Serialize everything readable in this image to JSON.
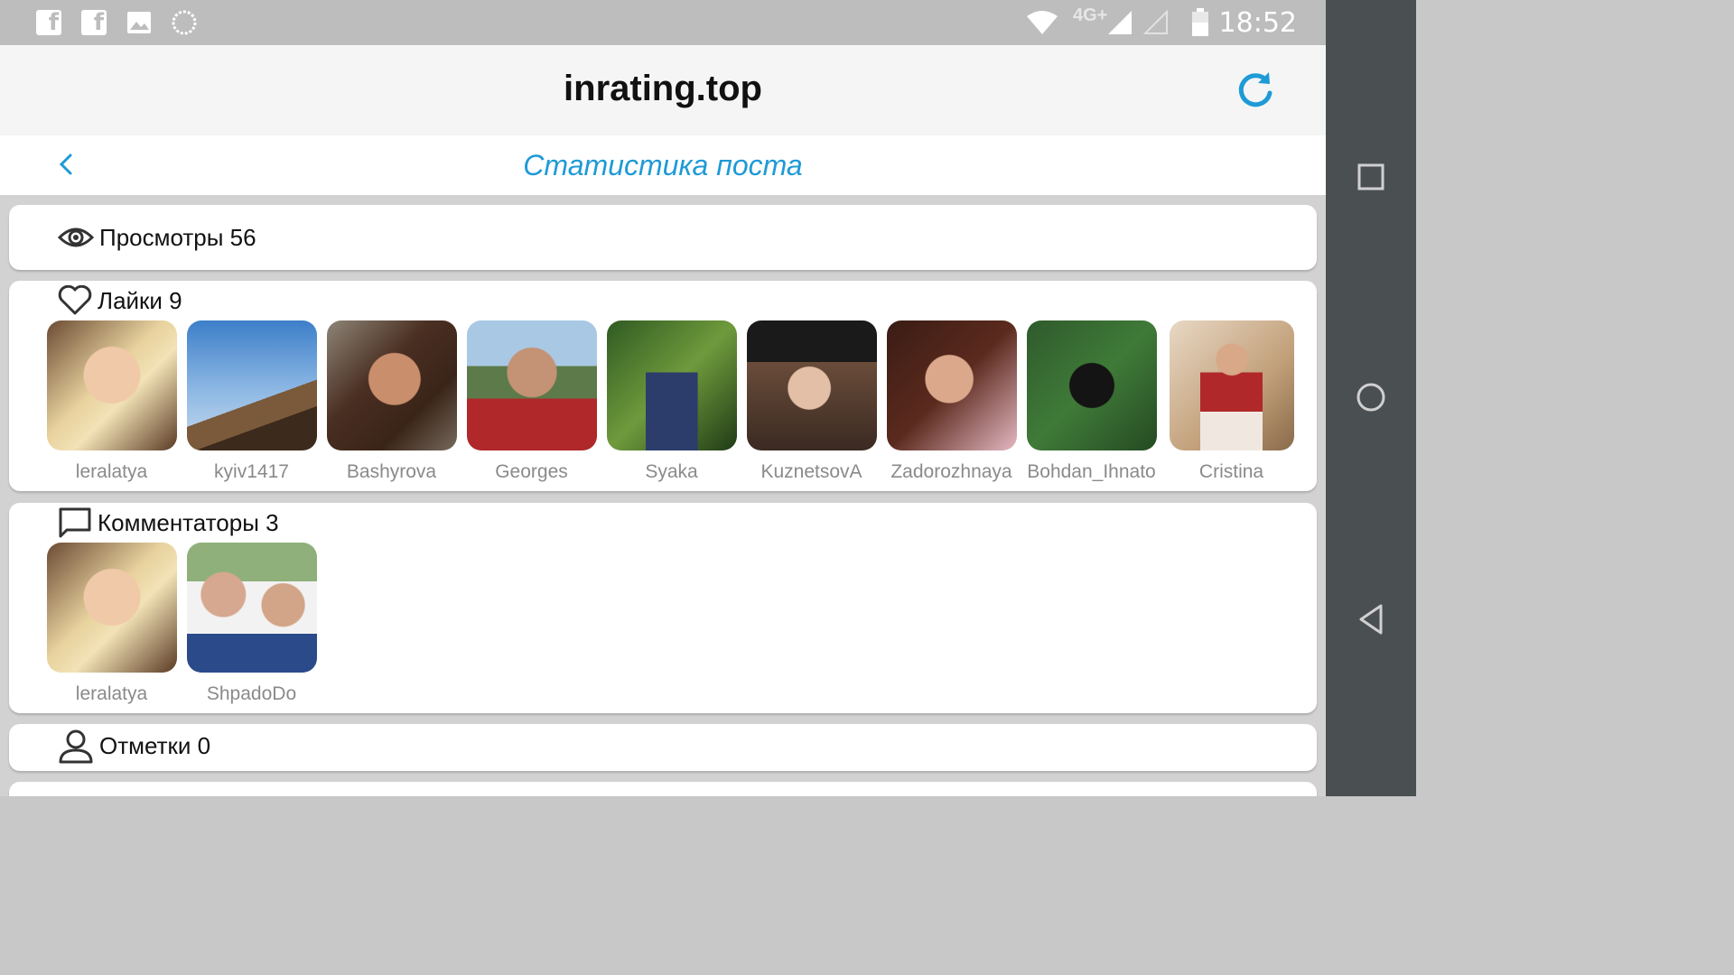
{
  "status_bar": {
    "time": "18:52",
    "network_label": "4G+",
    "notification_icons": [
      "facebook-icon",
      "facebook-icon",
      "image-icon",
      "sync-icon"
    ],
    "system_icons": [
      "wifi-icon",
      "signal-icon",
      "signal-empty-icon",
      "battery-icon"
    ]
  },
  "header": {
    "title": "inrating.top",
    "refresh_icon": "refresh-icon"
  },
  "subheader": {
    "title": "Статистика поста",
    "back_icon": "chevron-left-icon"
  },
  "sections": {
    "views": {
      "label": "Просмотры 56",
      "icon": "eye-icon"
    },
    "likes": {
      "label": "Лайки 9",
      "icon": "heart-icon",
      "users": [
        "leralatya",
        "kyiv1417",
        "Bashyrova",
        "Georges",
        "Syaka",
        "KuznetsovA",
        "Zadorozhnaya",
        "Bohdan_Ihnato",
        "Cristina"
      ]
    },
    "commenters": {
      "label": "Комментаторы 3",
      "icon": "comment-icon",
      "users": [
        "leralatya",
        "ShpadoDo"
      ]
    },
    "tags": {
      "label": "Отметки 0",
      "icon": "person-icon"
    }
  },
  "colors": {
    "accent": "#1e9ad6",
    "status_bar": "#bdbdbd",
    "nav_bar": "#4a4f52"
  }
}
